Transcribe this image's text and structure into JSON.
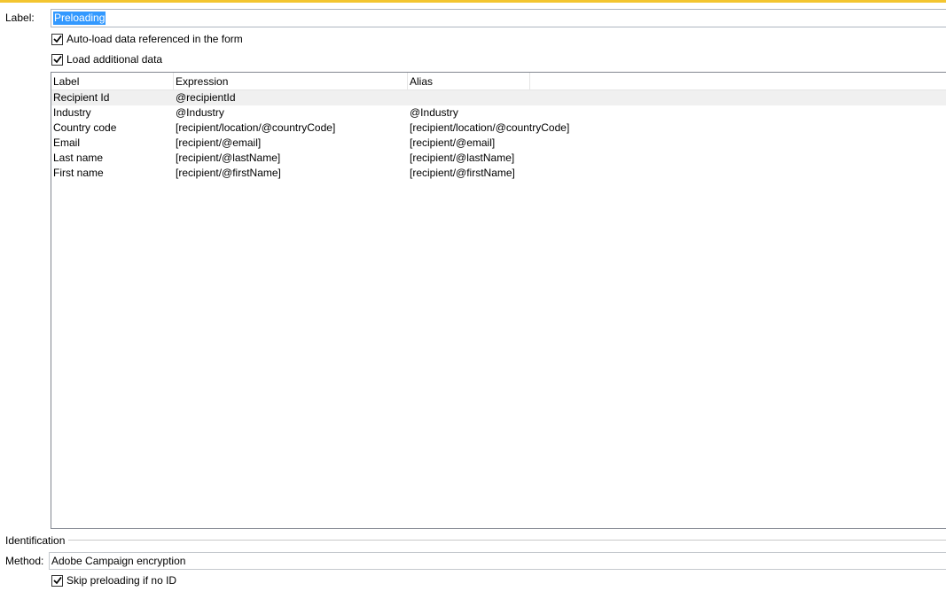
{
  "label_field": {
    "caption": "Label:",
    "value": "Preloading"
  },
  "options": {
    "autoload": {
      "label": "Auto-load data referenced in the form",
      "checked": true
    },
    "load_additional": {
      "label": "Load additional data",
      "checked": true
    }
  },
  "grid": {
    "columns": [
      "Label",
      "Expression",
      "Alias"
    ],
    "rows": [
      {
        "label": "Recipient Id",
        "expression": "@recipientId",
        "alias": ""
      },
      {
        "label": "Industry",
        "expression": "@Industry",
        "alias": "@Industry"
      },
      {
        "label": "Country code",
        "expression": "[recipient/location/@countryCode]",
        "alias": "[recipient/location/@countryCode]"
      },
      {
        "label": "Email",
        "expression": "[recipient/@email]",
        "alias": "[recipient/@email]"
      },
      {
        "label": "Last name",
        "expression": "[recipient/@lastName]",
        "alias": "[recipient/@lastName]"
      },
      {
        "label": "First name",
        "expression": "[recipient/@firstName]",
        "alias": "[recipient/@firstName]"
      }
    ],
    "selected_row": 0
  },
  "identification": {
    "group_title": "Identification",
    "method_caption": "Method:",
    "method_value": "Adobe Campaign encryption",
    "skip": {
      "label": "Skip preloading if no ID",
      "checked": true
    }
  },
  "colors": {
    "accent": "#f3c530",
    "selection": "#3399ff",
    "row_highlight": "#f0f0f0"
  }
}
